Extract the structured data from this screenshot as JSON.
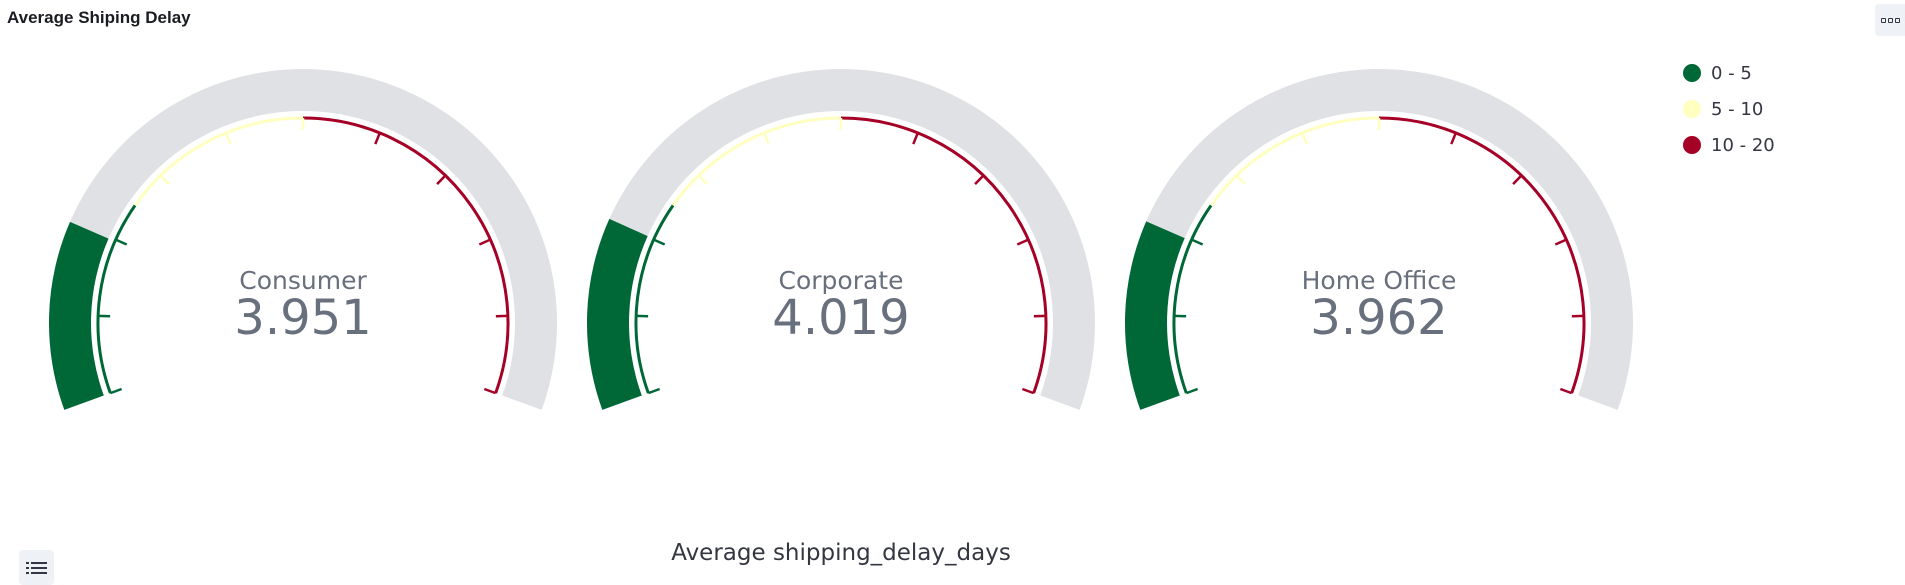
{
  "panel": {
    "title": "Average Shiping Delay",
    "options_icon": "panel-options-icon",
    "legend_toggle_icon": "list-icon"
  },
  "chart_data": {
    "type": "gauge",
    "title": "Average Shiping Delay",
    "xlabel": "Average shipping_delay_days",
    "range": [
      0,
      20
    ],
    "gauges": [
      {
        "label": "Consumer",
        "value": 3.951,
        "display": "3.951"
      },
      {
        "label": "Corporate",
        "value": 4.019,
        "display": "4.019"
      },
      {
        "label": "Home Office",
        "value": 3.962,
        "display": "3.962"
      }
    ],
    "bands": [
      {
        "label": "0 - 5",
        "from": 0,
        "to": 5,
        "color": "#006837"
      },
      {
        "label": "5 - 10",
        "from": 5,
        "to": 10,
        "color": "#ffffbf"
      },
      {
        "label": "10 - 20",
        "from": 10,
        "to": 20,
        "color": "#a50026"
      }
    ],
    "track_color": "#e0e1e5",
    "value_color": "#69707d",
    "legend_position": "top-right"
  }
}
